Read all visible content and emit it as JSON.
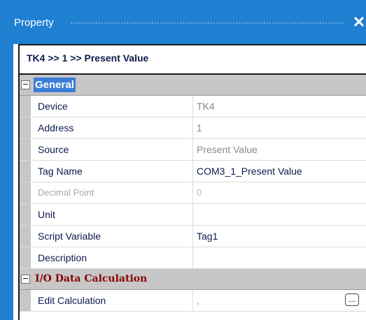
{
  "window": {
    "title": "Property",
    "close_glyph": "✕"
  },
  "breadcrumb": "TK4 >> 1 >> Present Value",
  "categories": [
    {
      "label": "General",
      "toggle": "−",
      "properties": [
        {
          "name": "Device",
          "value": "TK4"
        },
        {
          "name": "Address",
          "value": "1"
        },
        {
          "name": "Source",
          "value": "Present Value"
        },
        {
          "name": "Tag Name",
          "value": "COM3_1_Present Value"
        },
        {
          "name": "Decimal Point",
          "value": "0"
        },
        {
          "name": "Unit",
          "value": ""
        },
        {
          "name": "Script Variable",
          "value": "Tag1"
        },
        {
          "name": "Description",
          "value": ""
        }
      ]
    },
    {
      "label": "I/O Data Calculation",
      "toggle": "−",
      "properties": [
        {
          "name": "Edit Calculation",
          "value": ",",
          "button": "..."
        }
      ]
    }
  ],
  "colors": {
    "title_bar": "#1f7fd1",
    "category_text": "#8b0000",
    "selected_category_bg": "#3b7dd8",
    "property_text": "#0d1b4d"
  }
}
